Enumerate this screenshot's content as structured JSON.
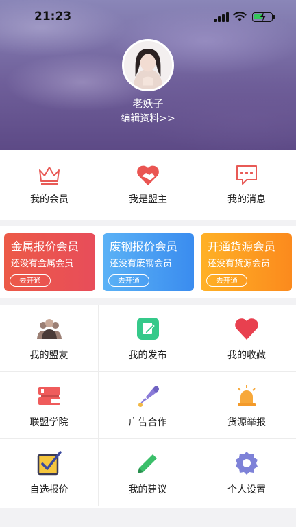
{
  "status_bar": {
    "time": "21:23"
  },
  "profile": {
    "name": "老妖子",
    "edit_label": "编辑资料>>"
  },
  "quick_menu": [
    {
      "label": "我的会员",
      "icon": "crown-icon"
    },
    {
      "label": "我是盟主",
      "icon": "handshake-heart-icon"
    },
    {
      "label": "我的消息",
      "icon": "chat-bubble-icon"
    }
  ],
  "member_cards": [
    {
      "title": "金属报价会员",
      "subtitle": "还没有金属会员",
      "button": "去开通",
      "color": "#e8534f"
    },
    {
      "title": "废钢报价会员",
      "subtitle": "还没有废钢会员",
      "button": "去开通",
      "color": "#4a9ff2"
    },
    {
      "title": "开通货源会员",
      "subtitle": "还没有货源会员",
      "button": "去开通",
      "color": "#fd9c20"
    }
  ],
  "grid": [
    {
      "label": "我的盟友",
      "icon": "people-icon"
    },
    {
      "label": "我的发布",
      "icon": "edit-note-icon"
    },
    {
      "label": "我的收藏",
      "icon": "heart-icon"
    },
    {
      "label": "联盟学院",
      "icon": "books-icon"
    },
    {
      "label": "广告合作",
      "icon": "megaphone-icon"
    },
    {
      "label": "货源举报",
      "icon": "alarm-light-icon"
    },
    {
      "label": "自选报价",
      "icon": "checkbox-icon"
    },
    {
      "label": "我的建议",
      "icon": "pencil-icon"
    },
    {
      "label": "个人设置",
      "icon": "gear-icon"
    }
  ]
}
